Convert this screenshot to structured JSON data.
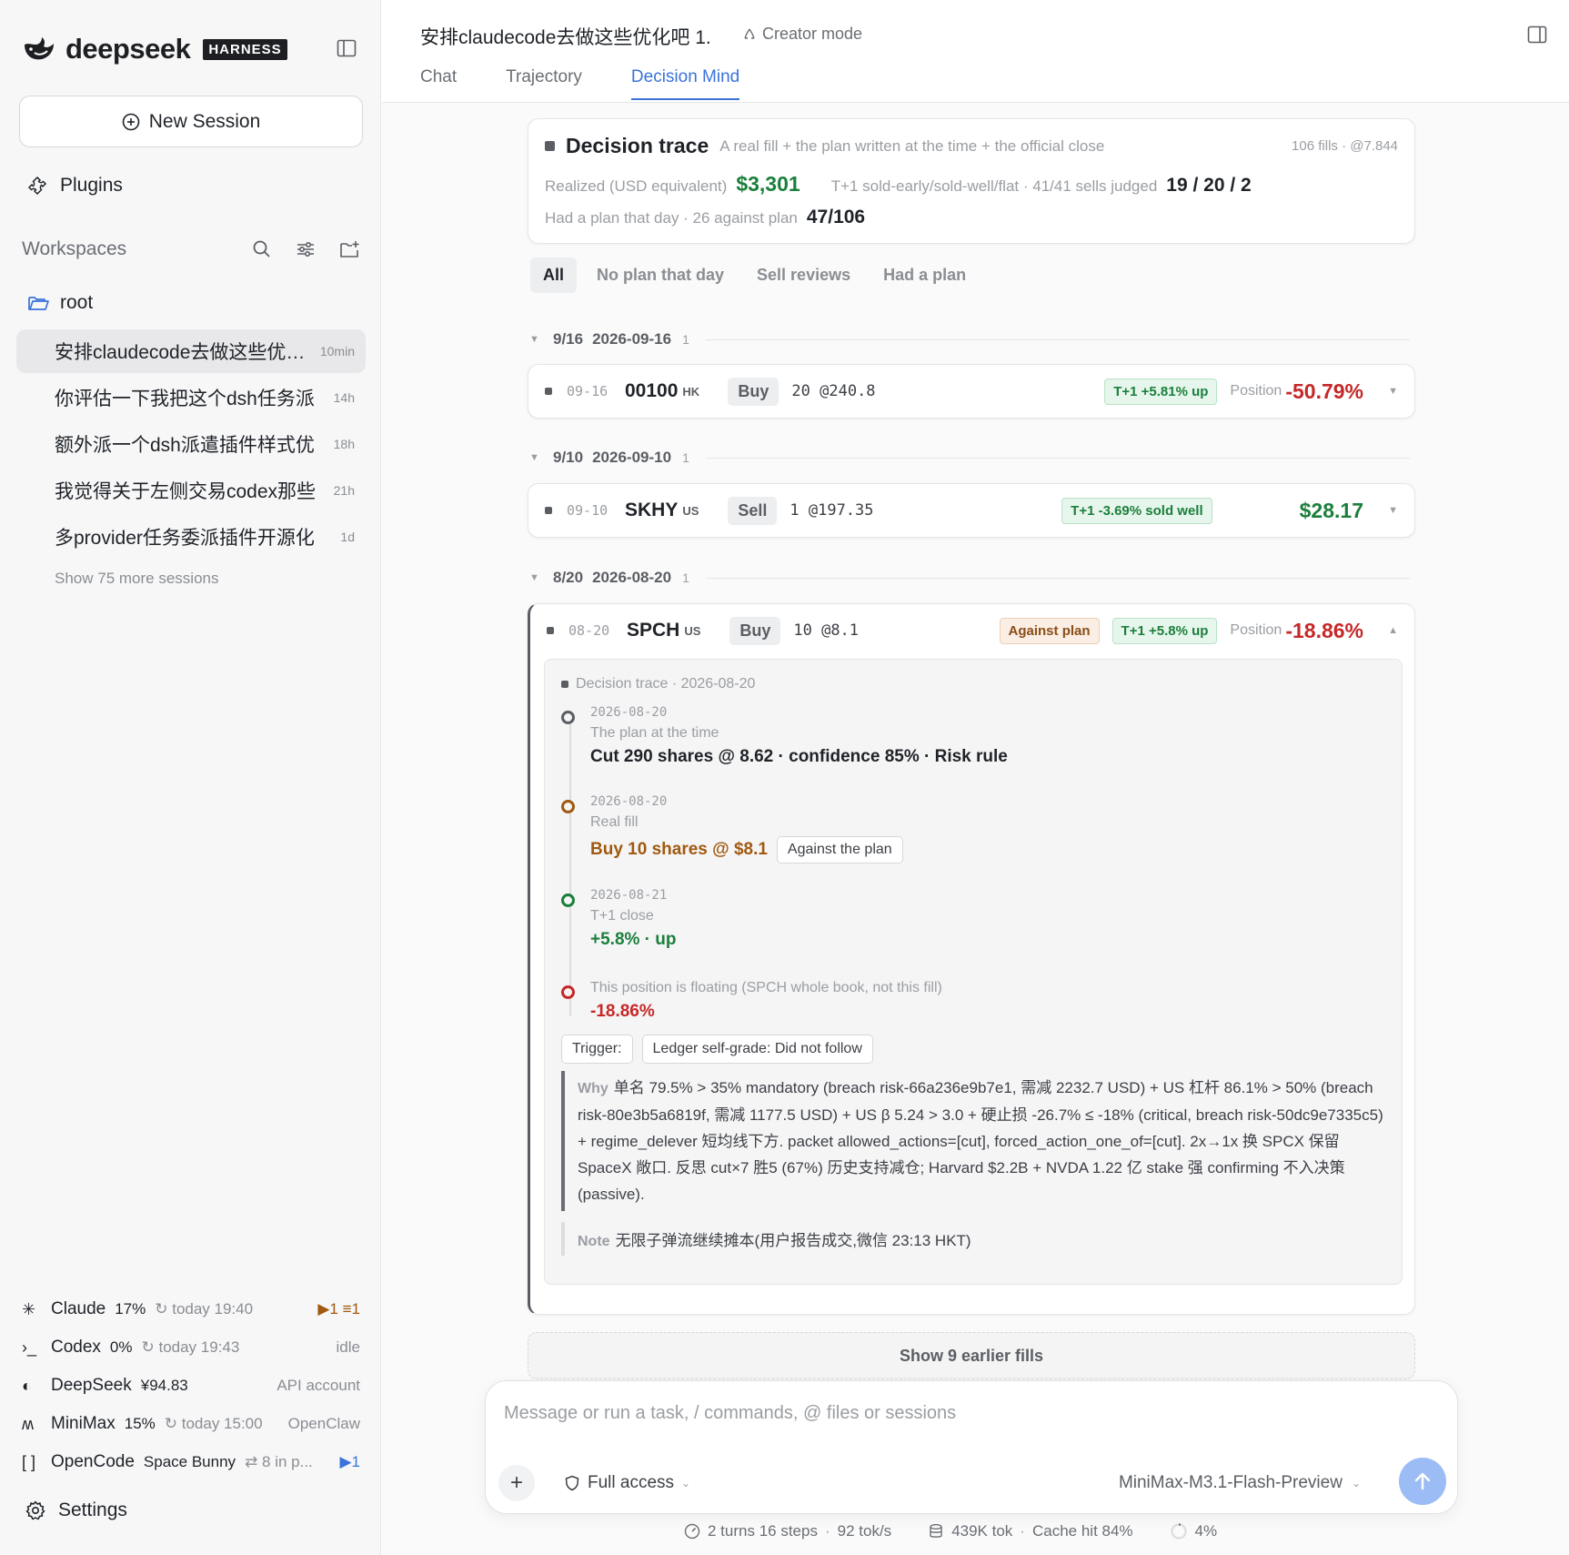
{
  "brand": {
    "name": "deepseek",
    "badge": "HARNESS"
  },
  "sidebar": {
    "new_session": "New Session",
    "plugins": "Plugins",
    "workspaces": "Workspaces",
    "root": "root",
    "sessions": [
      {
        "title": "安排claudecode去做这些优化吧 1.",
        "age": "10min"
      },
      {
        "title": "你评估一下我把这个dsh任务派",
        "age": "14h"
      },
      {
        "title": "额外派一个dsh派遣插件样式优",
        "age": "18h"
      },
      {
        "title": "我觉得关于左侧交易codex那些",
        "age": "21h"
      },
      {
        "title": "多provider任务委派插件开源化",
        "age": "1d"
      }
    ],
    "more_sessions": "Show 75 more sessions",
    "providers": [
      {
        "icon": "✳",
        "name": "Claude",
        "pct": "17%",
        "when": "↻ today 19:40",
        "right": "▶1 ≡1"
      },
      {
        "icon": "›_",
        "name": "Codex",
        "pct": "0%",
        "when": "↻ today 19:43",
        "right": "idle"
      },
      {
        "icon": "◐",
        "name": "DeepSeek",
        "pct": "¥94.83",
        "when": "",
        "right": "API account"
      },
      {
        "icon": "ʍ",
        "name": "MiniMax",
        "pct": "15%",
        "when": "↻ today 15:00",
        "right": "OpenClaw"
      },
      {
        "icon": "[ ]",
        "name": "OpenCode",
        "pct": "Space Bunny",
        "when": "⇄ 8 in p...",
        "right": "▶1"
      }
    ],
    "settings": "Settings"
  },
  "topbar": {
    "title": "安排claudecode去做这些优化吧 1.",
    "creator_mode": "Creator mode",
    "tabs": [
      "Chat",
      "Trajectory",
      "Decision Mind"
    ]
  },
  "summary": {
    "title": "Decision trace",
    "subtitle": "A real fill + the plan written at the time + the official close",
    "fills": "106 fills · @7.844",
    "realized_label": "Realized (USD equivalent)",
    "realized_value": "$3,301",
    "judged_label": "T+1 sold-early/sold-well/flat · 41/41 sells judged",
    "judged_value": "19 / 20 / 2",
    "plan_label": "Had a plan that day · 26 against plan",
    "plan_value": "47/106"
  },
  "filters": [
    "All",
    "No plan that day",
    "Sell reviews",
    "Had a plan"
  ],
  "groups": [
    {
      "short": "9/16",
      "date": "2026-09-16",
      "count": "1"
    },
    {
      "short": "9/10",
      "date": "2026-09-10",
      "count": "1"
    },
    {
      "short": "8/20",
      "date": "2026-08-20",
      "count": "1"
    }
  ],
  "fills": [
    {
      "date": "09-16",
      "symbol": "00100",
      "market": "HK",
      "side": "Buy",
      "qty": "20 @240.8",
      "tag": "T+1 +5.81% up",
      "pos_label": "Position",
      "pos_value": "-50.79%"
    },
    {
      "date": "09-10",
      "symbol": "SKHY",
      "market": "US",
      "side": "Sell",
      "qty": "1 @197.35",
      "tag": "T+1 -3.69% sold well",
      "pnl": "$28.17"
    },
    {
      "date": "08-20",
      "symbol": "SPCH",
      "market": "US",
      "side": "Buy",
      "qty": "10 @8.1",
      "tag_warn": "Against plan",
      "tag": "T+1 +5.8% up",
      "pos_label": "Position",
      "pos_value": "-18.86%"
    }
  ],
  "trace": {
    "head": "Decision trace · 2026-08-20",
    "nodes": [
      {
        "ts": "2026-08-20",
        "label": "The plan at the time",
        "value": "Cut 290 shares @ 8.62 · confidence 85% · Risk rule"
      },
      {
        "ts": "2026-08-20",
        "label": "Real fill",
        "value": "Buy 10 shares @ $8.1",
        "pill": "Against the plan"
      },
      {
        "ts": "2026-08-21",
        "label": "T+1 close",
        "value": "+5.8% · up"
      },
      {
        "label": "This position is floating (SPCH whole book, not this fill)",
        "value": "-18.86%"
      }
    ],
    "chips": [
      "Trigger:",
      "Ledger self-grade: Did not follow"
    ],
    "why_label": "Why",
    "why": "单名 79.5% > 35% mandatory (breach risk-66a236e9b7e1, 需减 2232.7 USD) + US 杠杆 86.1% > 50% (breach risk-80e3b5a6819f, 需减 1177.5 USD) + US β 5.24 > 3.0 + 硬止损 -26.7% ≤ -18% (critical, breach risk-50dc9e7335c5) + regime_delever 短均线下方. packet allowed_actions=[cut], forced_action_one_of=[cut]. 2x→1x 换 SPCX 保留 SpaceX 敞口. 反思 cut×7 胜5 (67%) 历史支持减仓; Harvard $2.2B + NVDA 1.22 亿 stake 强 confirming 不入决策 (passive).",
    "note_label": "Note",
    "note": "无限子弹流继续摊本(用户报告成交,微信 23:13 HKT)"
  },
  "earlier": "Show 9 earlier fills",
  "composer": {
    "placeholder": "Message or run a task, / commands, @ files or sessions",
    "access": "Full access",
    "model": "MiniMax-M3.1-Flash-Preview"
  },
  "stats": {
    "turns": "2 turns 16 steps",
    "speed": "92 tok/s",
    "tokens": "439K tok",
    "cache": "Cache hit 84%",
    "ctx": "4%"
  },
  "colors": {
    "accent": "#3a73d9",
    "gain": "#1b7f3b",
    "loss": "#c62828",
    "fill_orange": "#a0590f"
  }
}
